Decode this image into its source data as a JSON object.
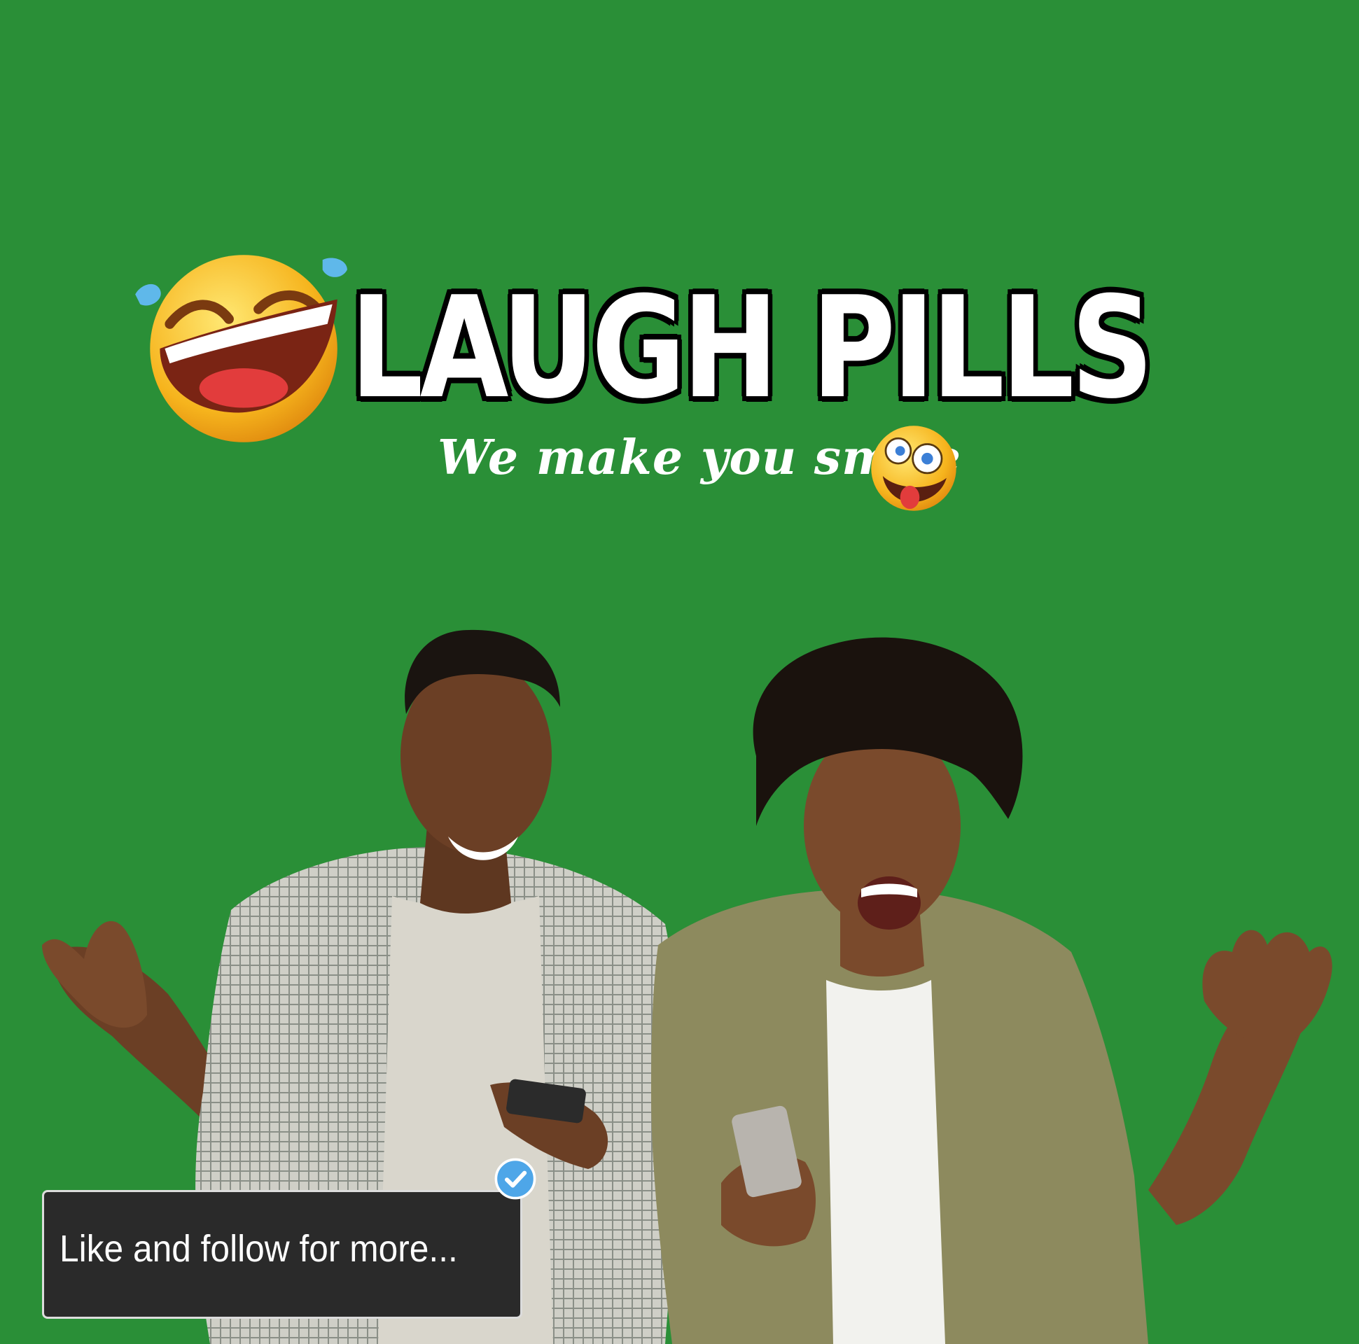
{
  "colors": {
    "background": "#2a8f37",
    "title_text": "#ffffff",
    "box_background": "#2a2a2a",
    "verified_badge": "#4ea6e8"
  },
  "branding": {
    "title": "LAUGH PILLS",
    "tagline": "We make you smile"
  },
  "icons": {
    "title_emoji": "rolling-laughing-tears-icon",
    "tagline_emoji": "crazy-face-tongue-icon",
    "badge": "verified-check-icon"
  },
  "callout": {
    "text": "Like and follow for more..."
  }
}
